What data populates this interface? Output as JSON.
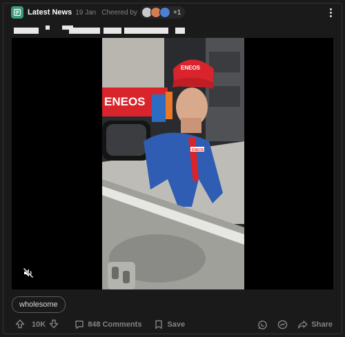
{
  "header": {
    "subreddit": "Latest News",
    "date": "19 Jan",
    "cheered_label": "Cheered by",
    "cheered_more": "+1"
  },
  "media": {
    "sign_text": "ENEOS",
    "cap_text": "ENEOS",
    "badge_text": "ENEOS"
  },
  "flair": "wholesome",
  "actions": {
    "votes": "10K",
    "comments": "848 Comments",
    "save": "Save",
    "share": "Share"
  },
  "colors": {
    "background": "#1a1a1b",
    "text": "#d7dadc",
    "muted": "#818384",
    "subreddit_icon": "#3c9a77"
  }
}
